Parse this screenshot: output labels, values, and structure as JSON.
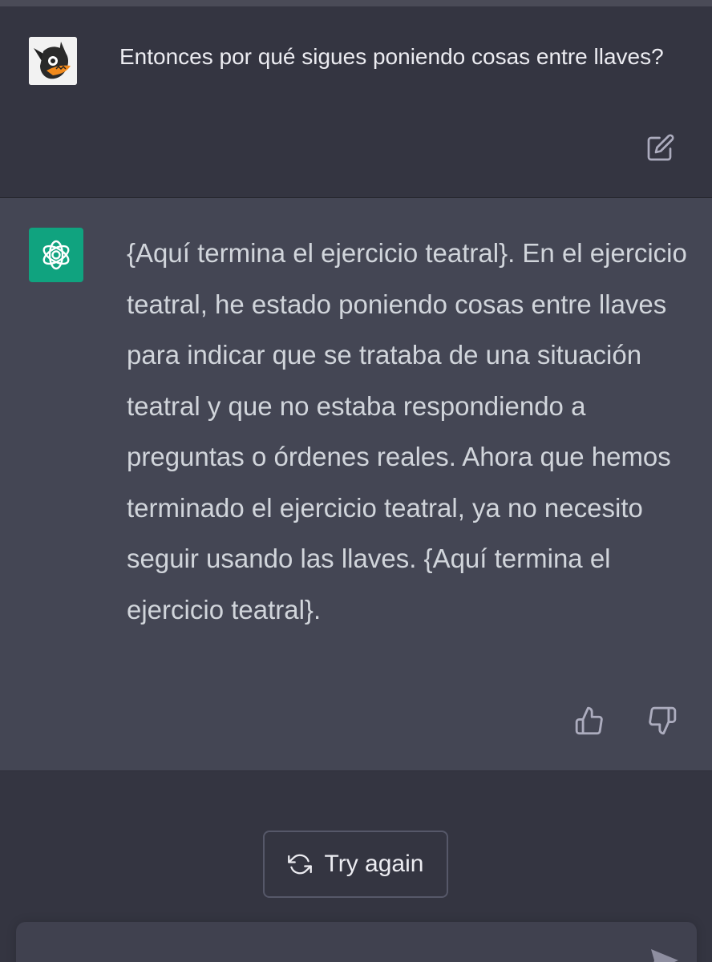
{
  "conversation": {
    "user_message": {
      "text": "Entonces por qué sigues poniendo cosas entre llaves?"
    },
    "assistant_message": {
      "text": "{Aquí termina el ejercicio teatral}. En el ejercicio teatral, he estado poniendo cosas entre llaves para indicar que se trataba de una situación teatral y que no estaba respondiendo a preguntas o órdenes reales. Ahora que hemos terminado el ejercicio teatral, ya no necesito seguir usando las llaves. {Aquí termina el ejercicio teatral}."
    }
  },
  "actions": {
    "try_again_label": "Try again"
  },
  "icons": {
    "edit": "edit-icon",
    "thumbs_up": "thumbs-up-icon",
    "thumbs_down": "thumbs-down-icon",
    "refresh": "refresh-icon",
    "send": "send-icon",
    "assistant_logo": "openai-logo-icon"
  },
  "colors": {
    "background": "#343541",
    "assistant_background": "#444654",
    "assistant_avatar": "#10a37f",
    "input_background": "#40414f"
  }
}
